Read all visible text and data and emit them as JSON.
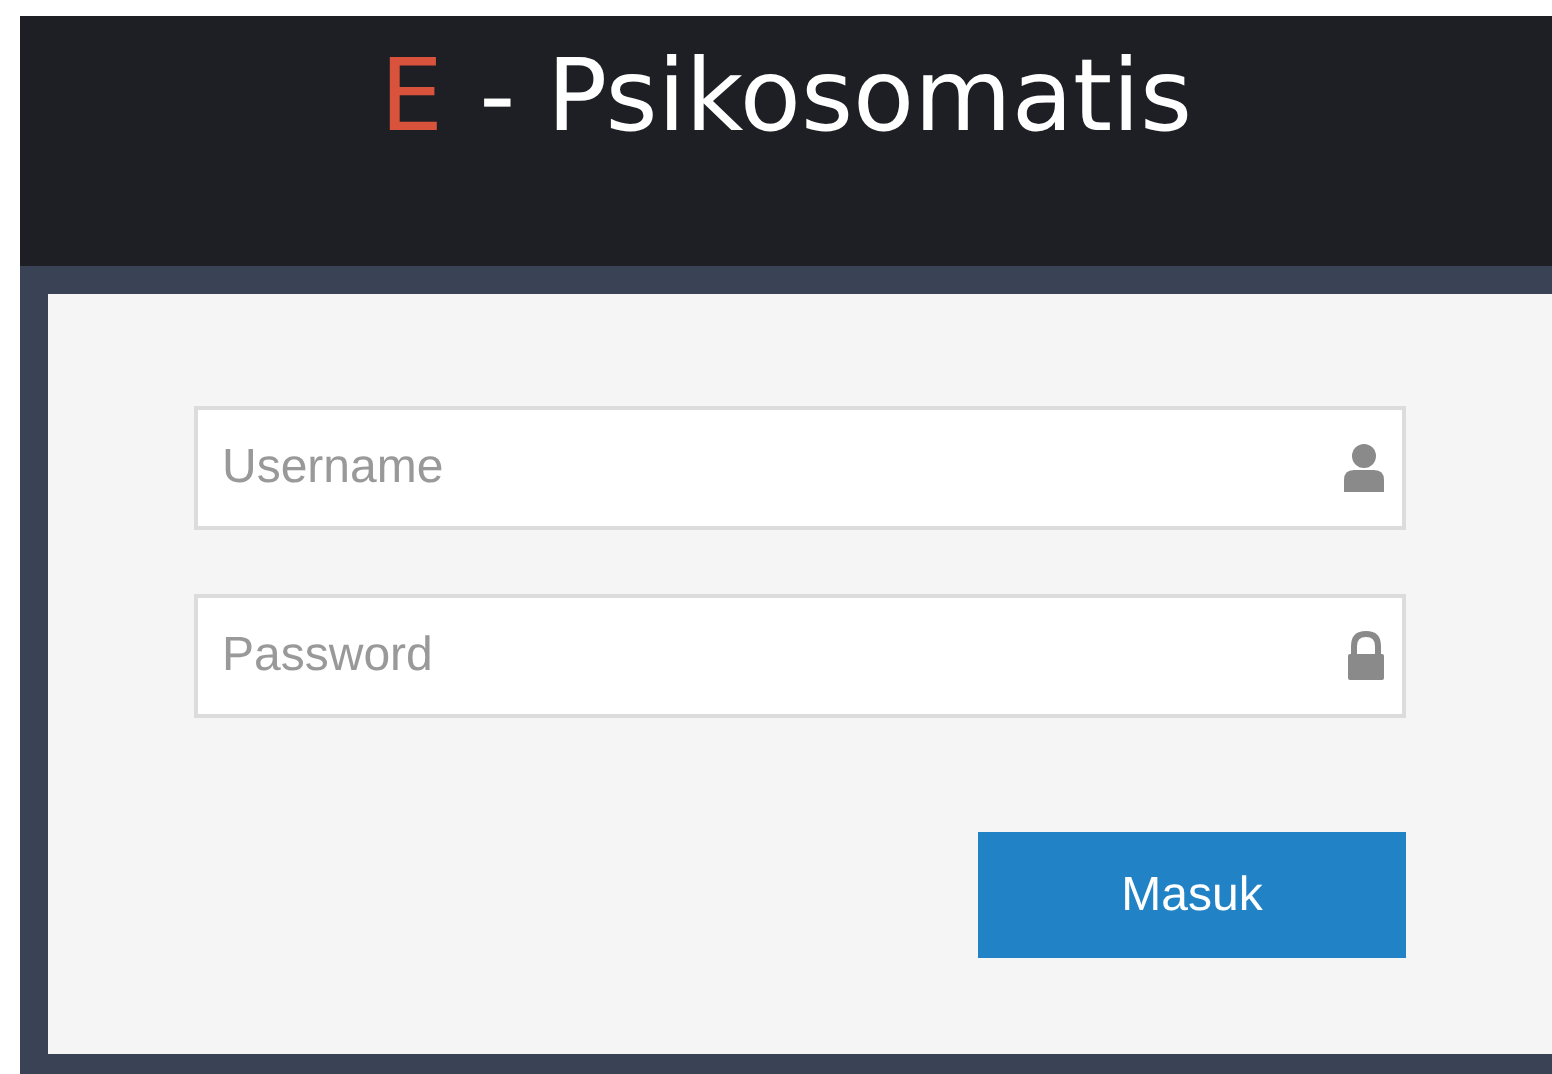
{
  "header": {
    "title_accent": "E",
    "title_rest": "- Psikosomatis"
  },
  "form": {
    "fields": [
      {
        "kind": "user",
        "placeholder": "Username"
      },
      {
        "kind": "password",
        "placeholder": "Password"
      }
    ],
    "submit_button": "Masuk"
  }
}
